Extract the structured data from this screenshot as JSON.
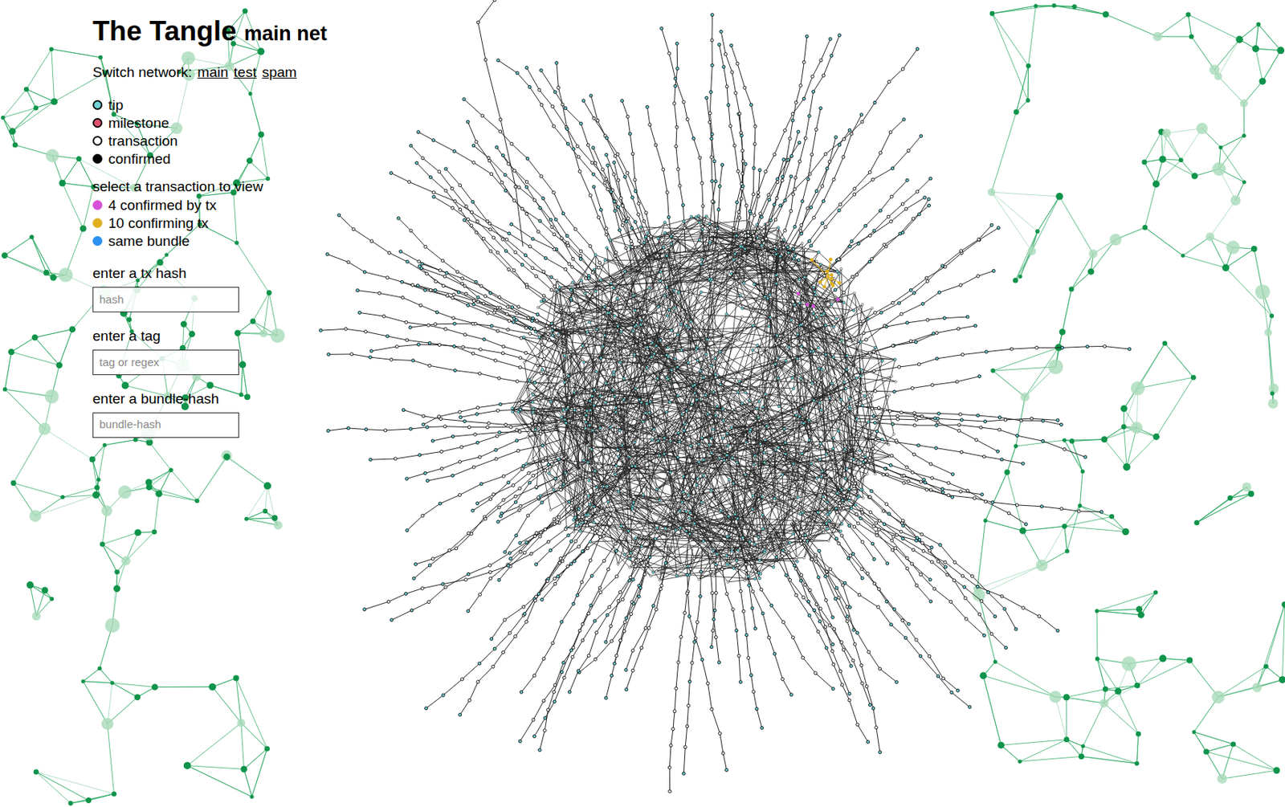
{
  "header": {
    "title": "The Tangle",
    "subtitle": "main net"
  },
  "network_switch": {
    "label": "Switch network:",
    "links": [
      {
        "label": "main"
      },
      {
        "label": "test"
      },
      {
        "label": "spam"
      }
    ]
  },
  "legend": [
    {
      "label": "tip",
      "color": "#6fd3d8"
    },
    {
      "label": "milestone",
      "color": "#e0506e"
    },
    {
      "label": "transaction",
      "color": "#ffffff"
    },
    {
      "label": "confirmed",
      "color": "#000000"
    }
  ],
  "selection_legend": {
    "title": "select a transaction to view",
    "items": [
      {
        "label": "4 confirmed by tx",
        "color": "#d84fd8"
      },
      {
        "label": "10 confirming tx",
        "color": "#e0b021"
      },
      {
        "label": "same bundle",
        "color": "#2b90f0"
      }
    ]
  },
  "search_fields": [
    {
      "label": "enter a tx hash",
      "placeholder": "hash"
    },
    {
      "label": "enter a tag",
      "placeholder": "tag or regex"
    },
    {
      "label": "enter a bundle-hash",
      "placeholder": "bundle-hash"
    }
  ]
}
